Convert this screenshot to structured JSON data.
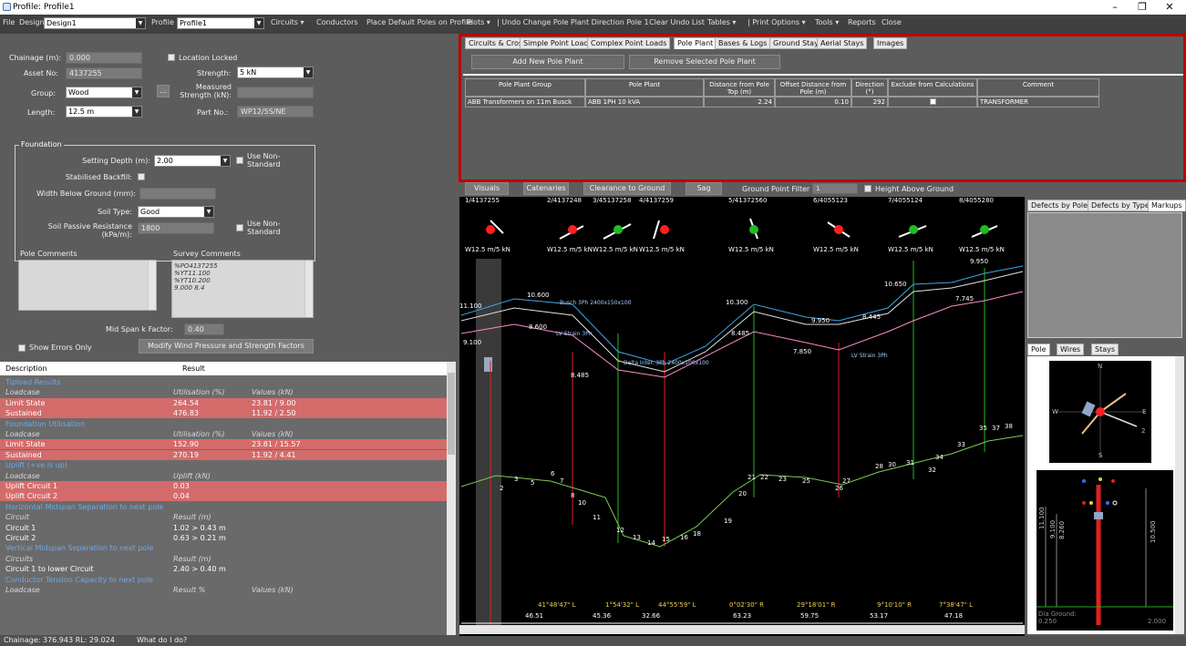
{
  "window": {
    "title": "Profile: Profile1"
  },
  "menu": {
    "file": "File",
    "design_label": "Design",
    "design_value": "Design1",
    "profile_label": "Profile",
    "profile_value": "Profile1",
    "circuits": "Circuits",
    "conductors": "Conductors",
    "place_default": "Place Default Poles on Profile",
    "plots": "Plots",
    "undo": "| Undo Change Pole Plant Direction Pole 1",
    "clear_undo": "Clear Undo List",
    "tables": "Tables",
    "print": "| Print Options",
    "tools": "Tools",
    "reports": "Reports",
    "close": "Close"
  },
  "pole": {
    "chainage_label": "Chainage (m):",
    "chainage": "0.000",
    "location_locked": "Location Locked",
    "asset_label": "Asset No:",
    "asset": "4137255",
    "strength_label": "Strength:",
    "strength": "5 kN",
    "group_label": "Group:",
    "group": "Wood",
    "measured_label": "Measured Strength (kN):",
    "length_label": "Length:",
    "length": "12.5 m",
    "part_label": "Part No.:",
    "part": "WP12/5S/NE",
    "dots": "..."
  },
  "foundation": {
    "title": "Foundation",
    "setting_label": "Setting Depth (m):",
    "setting": "2.00",
    "use_ns": "Use Non-Standard",
    "stabilised_label": "Stabilised Backfill:",
    "width_label": "Width Below Ground (mm):",
    "soil_label": "Soil Type:",
    "soil": "Good",
    "resist_label": "Soil Passive Resistance (kPa/m):",
    "resist": "1800",
    "use_ns2": "Use Non-Standard"
  },
  "comments": {
    "pole_label": "Pole Comments",
    "survey_label": "Survey Comments",
    "survey_lines": [
      "%PO4137255",
      "%YT11.100",
      "%YT10.200",
      "9.000 8.4"
    ],
    "midspan_label": "Mid Span k Factor:",
    "midspan": "0.40",
    "show_errors": "Show Errors Only",
    "modify_button": "Modify Wind Pressure and Strength Factors"
  },
  "results": {
    "col_desc": "Description",
    "col_result": "Result",
    "rows": [
      {
        "t": "sec",
        "a": "Tipload Results"
      },
      {
        "t": "sub",
        "a": "Loadcase",
        "b": "Utilisation (%)",
        "c": "Values (kN)"
      },
      {
        "t": "red",
        "a": "Limit State",
        "b": "264.54",
        "c": "23.81 / 9.00"
      },
      {
        "t": "red",
        "a": "Sustained",
        "b": "476.83",
        "c": "11.92 / 2.50"
      },
      {
        "t": "sec",
        "a": "Foundation Utilisation"
      },
      {
        "t": "sub",
        "a": "Loadcase",
        "b": "Utilisation (%)",
        "c": "Values (kN)"
      },
      {
        "t": "red",
        "a": "Limit State",
        "b": "152.90",
        "c": "23.81 / 15.57"
      },
      {
        "t": "red",
        "a": "Sustained",
        "b": "270.19",
        "c": "11.92 / 4.41"
      },
      {
        "t": "sec",
        "a": "Uplift (+ve is up)"
      },
      {
        "t": "sub",
        "a": "Loadcase",
        "b": "Uplift (kN)",
        "c": ""
      },
      {
        "t": "red",
        "a": "Uplift Circuit 1",
        "b": "0.03",
        "c": ""
      },
      {
        "t": "red",
        "a": "Uplift Circuit 2",
        "b": "0.04",
        "c": ""
      },
      {
        "t": "sec",
        "a": "Horizontal Midspan Separation to next pole"
      },
      {
        "t": "sub",
        "a": "Circuit",
        "b": "Result (m)",
        "c": ""
      },
      {
        "t": "nor",
        "a": "Circuit 1",
        "b": "1.02 > 0.43 m",
        "c": ""
      },
      {
        "t": "nor",
        "a": "Circuit 2",
        "b": "0.63 > 0.21 m",
        "c": ""
      },
      {
        "t": "sec",
        "a": "Vertical Midspan Separation to next pole"
      },
      {
        "t": "sub",
        "a": "Circuits",
        "b": "Result (m)",
        "c": ""
      },
      {
        "t": "nor",
        "a": "Circuit 1 to lower Circuit",
        "b": "2.40 > 0.40 m",
        "c": ""
      },
      {
        "t": "sec",
        "a": "Conductor Tension Capacity to next pole"
      },
      {
        "t": "sub",
        "a": "Loadcase",
        "b": "Result %",
        "c": "Values (kN)"
      }
    ]
  },
  "status": {
    "text": "Chainage: 376.943 RL: 29.024",
    "help": "What do I do?"
  },
  "tabs": [
    "Circuits & Crossarms",
    "Simple Point Loads",
    "Complex Point Loads",
    "Pole Plant",
    "Bases & Logs",
    "Ground Stays",
    "Aerial Stays",
    "Images"
  ],
  "pole_plant": {
    "add": "Add New Pole Plant",
    "remove": "Remove Selected Pole Plant",
    "headers": [
      "Pole Plant Group",
      "Pole Plant",
      "Distance from Pole Top (m)",
      "Offset Distance from Pole (m)",
      "Direction (°)",
      "Exclude from Calculations",
      "Comment"
    ],
    "row": [
      "ABB Transformers on 11m Busck",
      "ABB 1PH 10 kVA",
      "2.24",
      "0.10",
      "292",
      "",
      "TRANSFORMER"
    ]
  },
  "viewbar": {
    "visuals": "Visuals",
    "catenaries": "Catenaries",
    "clearance": "Clearance to Ground",
    "sag": "Sag",
    "filter_label": "Ground Point Filter",
    "filter": "1",
    "height": "Height Above Ground"
  },
  "profile": {
    "poles": [
      {
        "id": "1/4137255",
        "w": "W12.5 m/5 kN",
        "c": "#ff2020"
      },
      {
        "id": "2/4137248",
        "w": "W12.5 m/5 kN",
        "c": "#ff2020"
      },
      {
        "id": "3/45137258",
        "w": "W12.5 m/5 kN",
        "c": "#22bb22"
      },
      {
        "id": "4/4137259",
        "w": "W12.5 m/5 kN",
        "c": "#ff2020"
      },
      {
        "id": "5/41372560",
        "w": "W12.5 m/5 kN",
        "c": "#22bb22"
      },
      {
        "id": "6/4055123",
        "w": "W12.5 m/5 kN",
        "c": "#ff2020"
      },
      {
        "id": "7/4055124",
        "w": "W12.5 m/5 kN",
        "c": "#22bb22"
      },
      {
        "id": "8/4055280",
        "w": "W12.5 m/5 kN",
        "c": "#22bb22"
      }
    ],
    "heights": [
      "11.100",
      "9.100",
      "10.600",
      "8.600",
      "8.485",
      "10.300",
      "8.485",
      "9.950",
      "7.850",
      "8.445",
      "7.745",
      "10.650",
      "9.950"
    ],
    "labels": [
      "Busch 3Ph 2400x150x100",
      "LV Strain 3Ph",
      "Delta Inter. 3Ph 2400x100x100",
      "LV Strain 3Ph"
    ],
    "angles": [
      "41°48'47\" L",
      "1°54'32\" L",
      "44°55'59\" L",
      "0°02'30\" R",
      "29°18'01\" R",
      "9°10'10\" R",
      "7°38'47\" L"
    ],
    "spans": [
      "46.51",
      "45.36",
      "32.66",
      "63.23",
      "59.75",
      "53.17",
      "47.18"
    ]
  },
  "right": {
    "tabs_top": [
      "Defects by Pole",
      "Defects by Type",
      "Markups"
    ],
    "tabs_bot": [
      "Pole",
      "Wires",
      "Stays"
    ],
    "compass": {
      "n": "N",
      "s": "S",
      "e": "E",
      "w": "W",
      "two": "2"
    },
    "dia": "Dia Ground:",
    "dia_val": "0.250",
    "bot_val": "2.000",
    "h1": "11.100",
    "h2": "9.100",
    "h3": "8.260",
    "h4": "10.500"
  }
}
